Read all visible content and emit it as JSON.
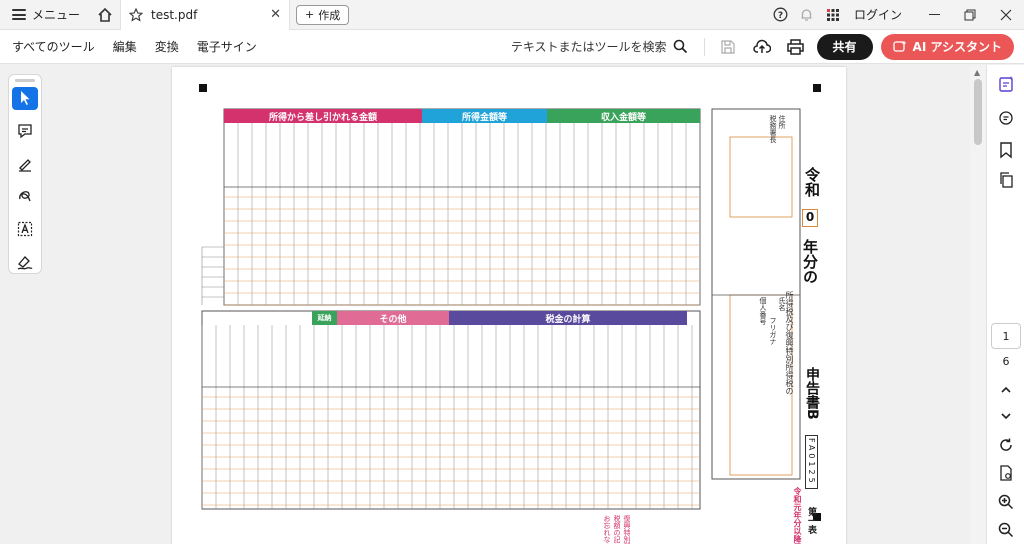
{
  "tabbar": {
    "menu_label": "メニュー",
    "tab_title": "test.pdf",
    "new_tab_label": "作成",
    "login_label": "ログイン"
  },
  "toolbar": {
    "menus": [
      "すべてのツール",
      "編集",
      "変換",
      "電子サイン"
    ],
    "search_label": "テキストまたはツールを検索",
    "share_label": "共有",
    "ai_label": "AI アシスタント",
    "ai_color": "#eb5757"
  },
  "sidebar": {
    "current_page": "1",
    "total_pages": "6"
  },
  "form": {
    "title_era": "令和",
    "title_year_box": "0",
    "title_main": "年分の",
    "title_tax": "所得税及び復興特別所得税の",
    "title_end": "申告書B",
    "form_code": "FA0125",
    "table_label": "第一表",
    "bottom_note": "令和元年分以降用",
    "bottom_warn": "復興特別所得税額の記入をお忘れなく。",
    "headers_top": [
      {
        "label": "収入金額等",
        "color": "#3aa35b"
      },
      {
        "label": "所得金額等",
        "color": "#1fa3d8"
      },
      {
        "label": "所得から差し引かれる金額",
        "color": "#d4326c"
      }
    ],
    "headers_bottom": [
      {
        "label": "税金の計算",
        "color": "#5a4a9e"
      },
      {
        "label": "その他",
        "color": "#e06b94"
      },
      {
        "label": "延納",
        "color": "#3aa35b"
      }
    ],
    "labels": {
      "address": "住所",
      "name": "氏名",
      "furigana": "フリガナ",
      "tax_office": "税務署長",
      "zip": "個人番号"
    }
  }
}
